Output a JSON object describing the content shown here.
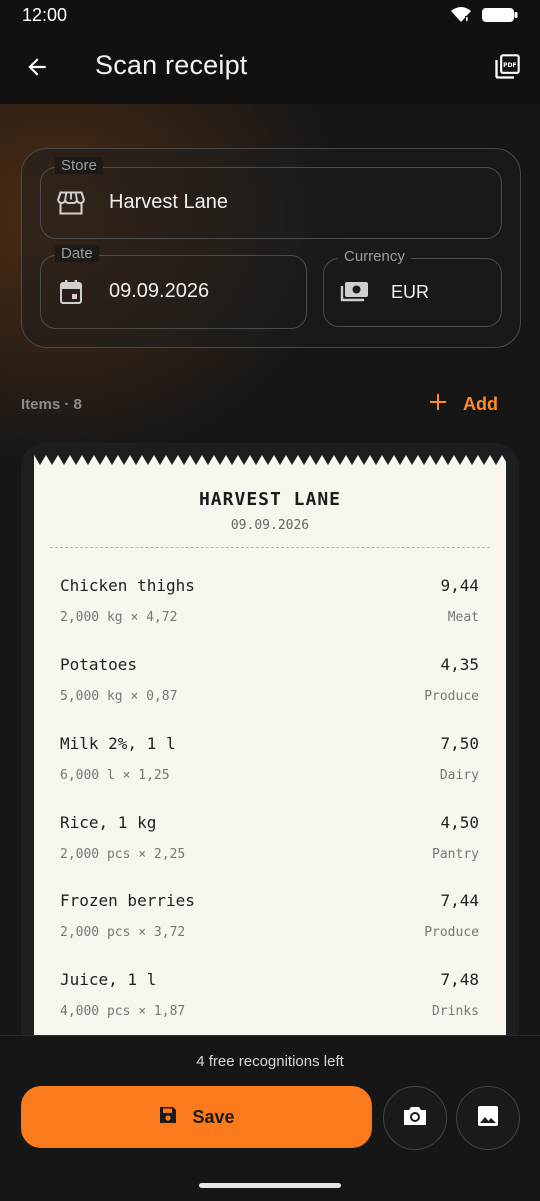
{
  "status": {
    "time": "12:00"
  },
  "appbar": {
    "title": "Scan receipt",
    "back_icon": "arrow-left-icon",
    "pdf_icon": "pdf-icon"
  },
  "form": {
    "store": {
      "label": "Store",
      "value": "Harvest Lane",
      "icon": "store-icon"
    },
    "date": {
      "label": "Date",
      "value": "09.09.2026",
      "icon": "calendar-icon"
    },
    "currency": {
      "label": "Currency",
      "value": "EUR",
      "icon": "money-icon"
    }
  },
  "items_header": {
    "label": "Items · 8",
    "add_label": "Add"
  },
  "receipt": {
    "store": "HARVEST LANE",
    "date": "09.09.2026",
    "items": [
      {
        "name": "Chicken thighs",
        "price": "9,44",
        "qty": "2,000 kg × 4,72",
        "category": "Meat"
      },
      {
        "name": "Potatoes",
        "price": "4,35",
        "qty": "5,000 kg × 0,87",
        "category": "Produce"
      },
      {
        "name": "Milk 2%, 1 l",
        "price": "7,50",
        "qty": "6,000 l × 1,25",
        "category": "Dairy"
      },
      {
        "name": "Rice, 1 kg",
        "price": "4,50",
        "qty": "2,000 pcs × 2,25",
        "category": "Pantry"
      },
      {
        "name": "Frozen berries",
        "price": "7,44",
        "qty": "2,000 pcs × 3,72",
        "category": "Produce"
      },
      {
        "name": "Juice, 1 l",
        "price": "7,48",
        "qty": "4,000 pcs × 1,87",
        "category": "Drinks"
      }
    ]
  },
  "bottom": {
    "free_left": "4 free recognitions left",
    "save_label": "Save",
    "camera_icon": "camera-icon",
    "gallery_icon": "image-icon"
  },
  "colors": {
    "accent": "#fb7a1c",
    "background": "#141414",
    "receipt_paper": "#f8f5ee"
  }
}
